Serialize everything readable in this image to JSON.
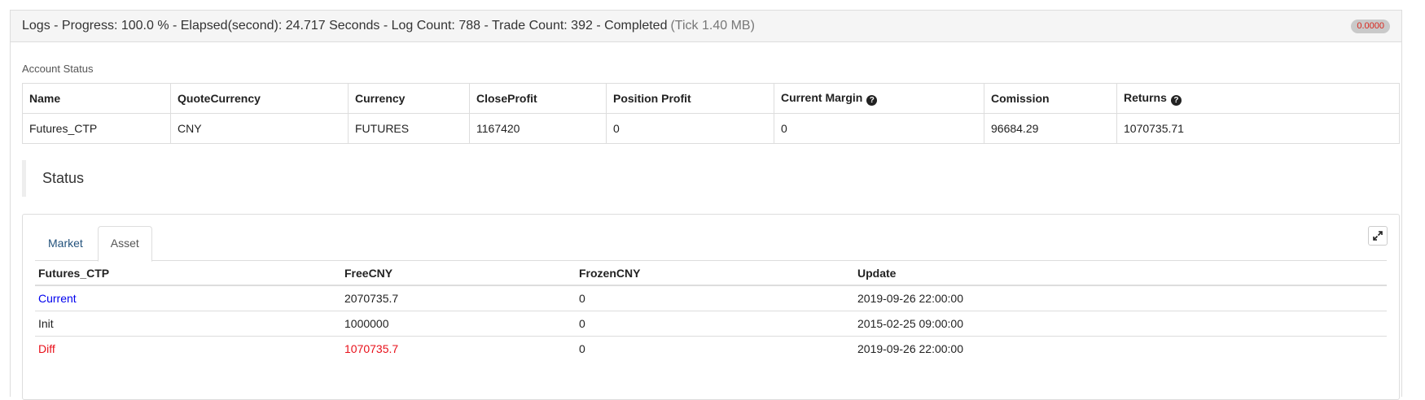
{
  "header": {
    "title": "Logs - Progress: 100.0 % - Elapsed(second): 24.717 Seconds - Log Count: 788 - Trade Count: 392 - Completed",
    "tick": "(Tick 1.40 MB)",
    "badge": "0.0000"
  },
  "account_status": {
    "label": "Account Status",
    "columns": [
      "Name",
      "QuoteCurrency",
      "Currency",
      "CloseProfit",
      "Position Profit",
      "Current Margin",
      "Comission",
      "Returns"
    ],
    "row": [
      "Futures_CTP",
      "CNY",
      "FUTURES",
      "1167420",
      "0",
      "0",
      "96684.29",
      "1070735.71"
    ]
  },
  "status": {
    "title": "Status",
    "tabs": [
      "Market",
      "Asset"
    ],
    "active_tab": "Asset",
    "asset_table": {
      "columns": [
        "Futures_CTP",
        "FreeCNY",
        "FrozenCNY",
        "Update"
      ],
      "rows": [
        [
          "Current",
          "2070735.7",
          "0",
          "2019-09-26 22:00:00"
        ],
        [
          "Init",
          "1000000",
          "0",
          "2015-02-25 09:00:00"
        ],
        [
          "Diff",
          "1070735.7",
          "0",
          "2019-09-26 22:00:00"
        ]
      ]
    }
  },
  "icons": {
    "help": "question-circle-icon",
    "expand": "expand-icon"
  },
  "colors": {
    "link_blue": "#0000ee",
    "diff_red": "#e8101a",
    "badge_red": "#d9261c"
  }
}
